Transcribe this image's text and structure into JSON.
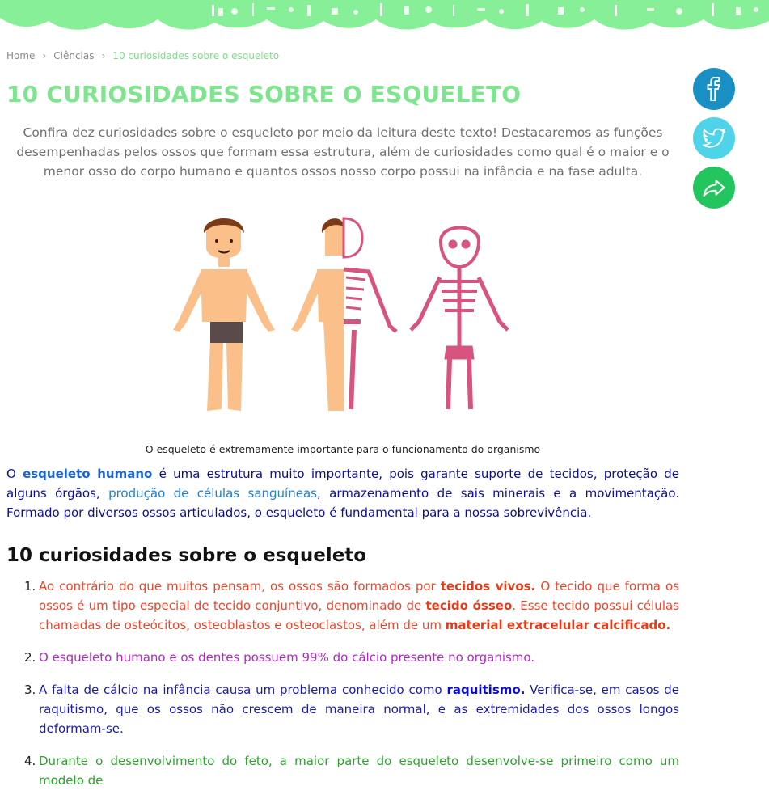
{
  "breadcrumb": {
    "home": "Home",
    "section": "Ciências",
    "current": "10 curiosidades sobre o esqueleto"
  },
  "page_title": "10 CURIOSIDADES SOBRE O ESQUELETO",
  "lead": "Confira dez curiosidades sobre o esqueleto por meio da leitura deste texto! Destacaremos as funções desempenhadas pelos ossos que formam essa estrutura, além de curiosidades como qual é o maior e o menor osso do corpo humano e quantos ossos nosso corpo possui na infância e na fase adulta.",
  "share": [
    {
      "icon": "facebook-icon",
      "color": "#1a8fc4"
    },
    {
      "icon": "twitter-icon",
      "color": "#4fd3e8"
    },
    {
      "icon": "share-arrow-icon",
      "color": "#22c55e"
    }
  ],
  "figure_caption": "O esqueleto é extremamente importante para o funcionamento do organismo",
  "intro": {
    "p1": "O ",
    "link_esqueleto": "esqueleto humano",
    "p2": " é uma estrutura muito importante, pois garante suporte de tecidos, proteção de alguns órgãos, ",
    "link_celulas": "produção de células sanguíneas",
    "p3": ", armazenamento de sais minerais e a movimentação. Formado por diversos ossos articulados, o esqueleto é fundamental para a nossa sobrevivência."
  },
  "section_heading": "10 curiosidades sobre o esqueleto",
  "items": {
    "i1": {
      "num": "1.",
      "a": "Ao contrário do que muitos pensam, os ossos são formados por ",
      "b1": "tecidos vivos.",
      "c": " O tecido que forma os ossos é um tipo especial de tecido conjuntivo, denominado de ",
      "b2": "tecido ósseo",
      "d": ". Esse tecido possui células chamadas de osteócitos, osteoblastos e osteoclastos, além de um ",
      "b3": "material extracelular calcificado."
    },
    "i2": {
      "num": "2.",
      "a": "O esqueleto humano e os dentes possuem 99% do cálcio presente no organismo."
    },
    "i3": {
      "num": "3.",
      "a": "A falta de cálcio na infância causa um problema conhecido como ",
      "b1": "raquitismo.",
      "c": " Verifica-se, em casos de raquitismo, que os ossos não crescem de maneira normal, e as extremidades dos ossos longos deformam-se."
    },
    "i4": {
      "num": "4.",
      "a": "Durante o desenvolvimento do feto, a maior parte do esqueleto desenvolve-se primeiro como um modelo de"
    }
  },
  "colors": {
    "accent": "#7ee48e",
    "banner": "#86ef97"
  }
}
